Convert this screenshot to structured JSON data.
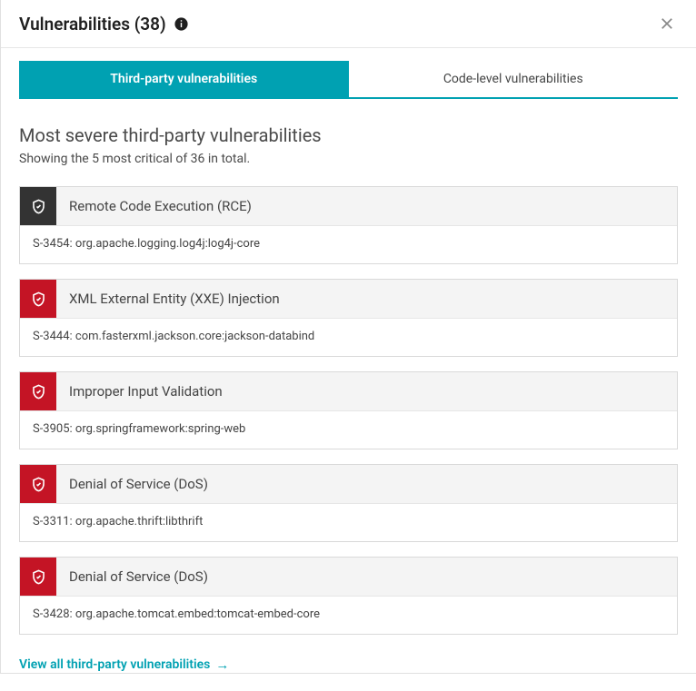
{
  "header": {
    "title": "Vulnerabilities (38)"
  },
  "tabs": {
    "thirdParty": "Third-party vulnerabilities",
    "codeLevel": "Code-level vulnerabilities"
  },
  "section": {
    "title": "Most severe third-party vulnerabilities",
    "subtitle": "Showing the 5 most critical of 36 in total."
  },
  "vulns": [
    {
      "severity": "black",
      "title": "Remote Code Execution (RCE)",
      "detail": "S-3454: org.apache.logging.log4j:log4j-core"
    },
    {
      "severity": "red",
      "title": "XML External Entity (XXE) Injection",
      "detail": "S-3444: com.fasterxml.jackson.core:jackson-databind"
    },
    {
      "severity": "red",
      "title": "Improper Input Validation",
      "detail": "S-3905: org.springframework:spring-web"
    },
    {
      "severity": "red",
      "title": "Denial of Service (DoS)",
      "detail": "S-3311: org.apache.thrift:libthrift"
    },
    {
      "severity": "red",
      "title": "Denial of Service (DoS)",
      "detail": "S-3428: org.apache.tomcat.embed:tomcat-embed-core"
    }
  ],
  "viewAll": "View all third-party vulnerabilities"
}
